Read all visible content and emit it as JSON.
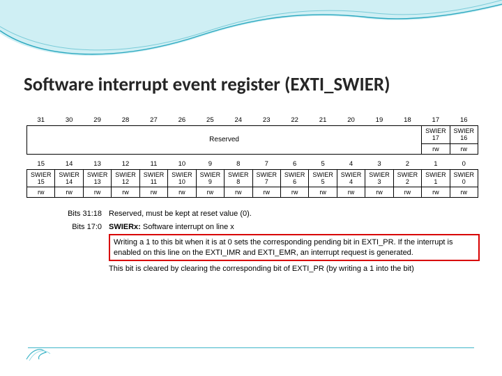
{
  "title": "Software interrupt event register (EXTI_SWIER)",
  "bits_high": [
    "31",
    "30",
    "29",
    "28",
    "27",
    "26",
    "25",
    "24",
    "23",
    "22",
    "21",
    "20",
    "19",
    "18",
    "17",
    "16"
  ],
  "high_reserved": "Reserved",
  "high_names": [
    {
      "l1": "SWIER",
      "l2": "17"
    },
    {
      "l1": "SWIER",
      "l2": "16"
    }
  ],
  "high_rw": [
    "rw",
    "rw"
  ],
  "bits_low": [
    "15",
    "14",
    "13",
    "12",
    "11",
    "10",
    "9",
    "8",
    "7",
    "6",
    "5",
    "4",
    "3",
    "2",
    "1",
    "0"
  ],
  "low_names": [
    {
      "l1": "SWIER",
      "l2": "15"
    },
    {
      "l1": "SWIER",
      "l2": "14"
    },
    {
      "l1": "SWIER",
      "l2": "13"
    },
    {
      "l1": "SWIER",
      "l2": "12"
    },
    {
      "l1": "SWIER",
      "l2": "11"
    },
    {
      "l1": "SWIER",
      "l2": "10"
    },
    {
      "l1": "SWIER",
      "l2": "9"
    },
    {
      "l1": "SWIER",
      "l2": "8"
    },
    {
      "l1": "SWIER",
      "l2": "7"
    },
    {
      "l1": "SWIER",
      "l2": "6"
    },
    {
      "l1": "SWIER",
      "l2": "5"
    },
    {
      "l1": "SWIER",
      "l2": "4"
    },
    {
      "l1": "SWIER",
      "l2": "3"
    },
    {
      "l1": "SWIER",
      "l2": "2"
    },
    {
      "l1": "SWIER",
      "l2": "1"
    },
    {
      "l1": "SWIER",
      "l2": "0"
    }
  ],
  "low_rw": [
    "rw",
    "rw",
    "rw",
    "rw",
    "rw",
    "rw",
    "rw",
    "rw",
    "rw",
    "rw",
    "rw",
    "rw",
    "rw",
    "rw",
    "rw",
    "rw"
  ],
  "descriptions": {
    "r1_label": "Bits 31:18",
    "r1_text": "Reserved, must be kept at reset value (0).",
    "r2_label": "Bits 17:0",
    "r2_head_bold": "SWIERx:",
    "r2_head_rest": " Software interrupt on line x",
    "r2_boxed": "Writing a 1 to this bit when it is at 0 sets the corresponding pending bit in EXTI_PR. If the interrupt is enabled on this line on the EXTI_IMR and EXTI_EMR, an interrupt request is generated.",
    "r2_tail": "This bit is cleared by clearing the corresponding bit of EXTI_PR (by writing a 1 into the bit)"
  }
}
